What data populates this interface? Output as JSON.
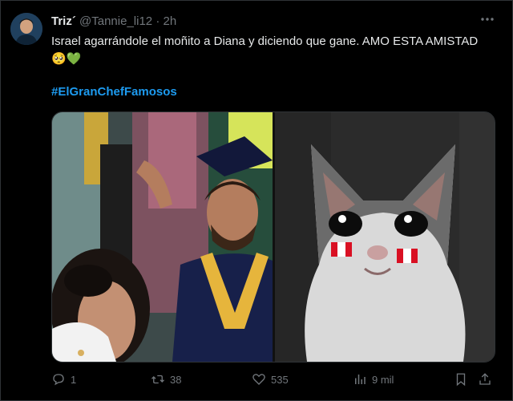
{
  "post": {
    "author_name": "Triz´",
    "handle": "@Tannie_li12",
    "separator": "·",
    "time": "2h",
    "text": "Israel agarrándole el moñito a Diana y diciendo que gane. AMO ESTA AMISTAD 🥺💚",
    "hashtag": "#ElGranChefFamosos"
  },
  "actions": {
    "replies": "1",
    "reposts": "38",
    "likes": "535",
    "views": "9 mil"
  },
  "colors": {
    "background": "#000000",
    "text": "#e7e9ea",
    "muted": "#71767b",
    "accent": "#1d9bf0"
  }
}
